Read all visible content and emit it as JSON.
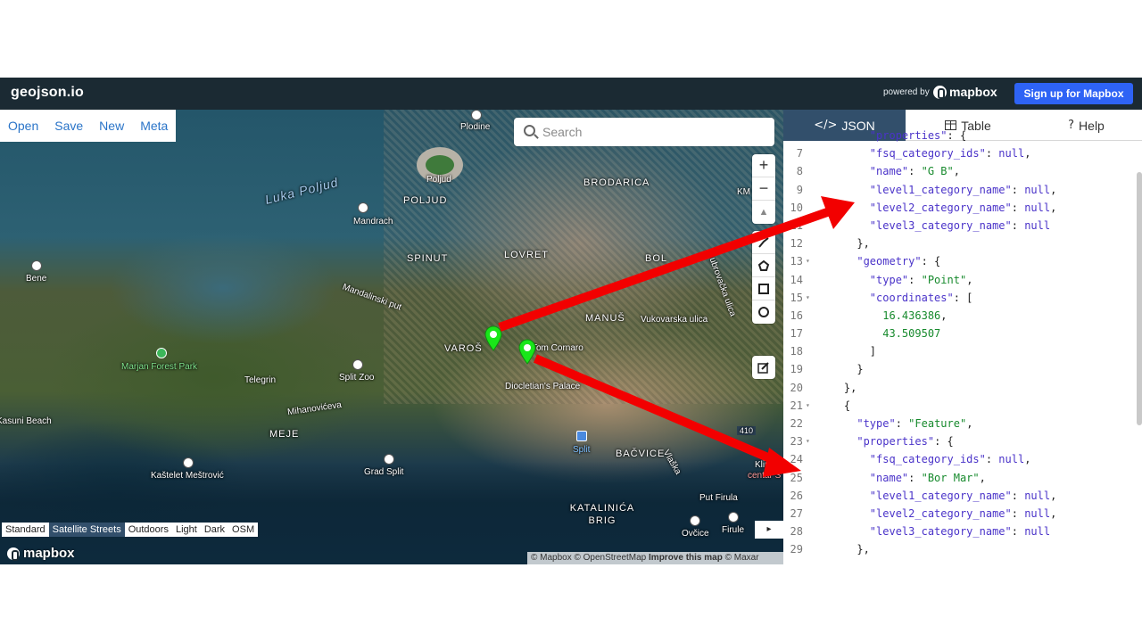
{
  "header": {
    "brand": "geojson.io",
    "powered_by": "powered by",
    "mapbox_logo": "mapbox",
    "signup_label": "Sign up for Mapbox"
  },
  "menu": {
    "open": "Open",
    "save": "Save",
    "new": "New",
    "meta": "Meta"
  },
  "search": {
    "placeholder": "Search"
  },
  "controls": {
    "zoom_in": "+",
    "zoom_out": "−",
    "compass": "▲"
  },
  "map_labels": [
    "Poljud",
    "Luka Poljud",
    "Mandrach",
    "POLJUD",
    "BRODARICA",
    "Plodine",
    "KM",
    "SPINUT",
    "LOVRET",
    "BOL",
    "Bene",
    "Mandalinski put",
    "Vukovarska ulica",
    "MANUŠ",
    "Dubrovačka ulica",
    "VAROŠ",
    "Tom Cornaro",
    "Diocletian's Palace",
    "Marjan Forest Park",
    "Telegrin",
    "Split Zoo",
    "Kasuni Beach",
    "Mihanovićeva",
    "MEJE",
    "Kaštelet Meštrović",
    "Grad Split",
    "Split",
    "BAČVICE",
    "Kliniy",
    "centar S",
    "Vlaška",
    "Put Firula",
    "KATALINIĆA BRIG",
    "Ovčice",
    "Firule",
    "410"
  ],
  "map_styles": [
    "Standard",
    "Satellite Streets",
    "Outdoors",
    "Light",
    "Dark",
    "OSM"
  ],
  "map_styles_active": "Satellite Streets",
  "map_logo": "mapbox",
  "attribution": {
    "a": "© Mapbox © OpenStreetMap ",
    "improve": "Improve this map",
    "b": " © Maxar"
  },
  "expand": "▸",
  "tabs": {
    "json": "JSON",
    "table": "Table",
    "help": "Help"
  },
  "icons": {
    "json": "code-icon",
    "table": "table-icon",
    "help": "help-icon"
  },
  "code_lines": [
    {
      "n": "",
      "t": "        \"properties\": {"
    },
    {
      "n": "7",
      "t": "        \"fsq_category_ids\": null,"
    },
    {
      "n": "8",
      "t": "        \"name\": \"G B\","
    },
    {
      "n": "9",
      "t": "        \"level1_category_name\": null,"
    },
    {
      "n": "10",
      "t": "        \"level2_category_name\": null,"
    },
    {
      "n": "11",
      "t": "        \"level3_category_name\": null"
    },
    {
      "n": "12",
      "t": "      },"
    },
    {
      "n": "13",
      "t": "      \"geometry\": {",
      "fold": true
    },
    {
      "n": "14",
      "t": "        \"type\": \"Point\","
    },
    {
      "n": "15",
      "t": "        \"coordinates\": [",
      "fold": true
    },
    {
      "n": "16",
      "t": "          16.436386,"
    },
    {
      "n": "17",
      "t": "          43.509507"
    },
    {
      "n": "18",
      "t": "        ]"
    },
    {
      "n": "19",
      "t": "      }"
    },
    {
      "n": "20",
      "t": "    },"
    },
    {
      "n": "21",
      "t": "    {",
      "fold": true
    },
    {
      "n": "22",
      "t": "      \"type\": \"Feature\","
    },
    {
      "n": "23",
      "t": "      \"properties\": {",
      "fold": true
    },
    {
      "n": "24",
      "t": "        \"fsq_category_ids\": null,"
    },
    {
      "n": "25",
      "t": "        \"name\": \"Bor Mar\","
    },
    {
      "n": "26",
      "t": "        \"level1_category_name\": null,"
    },
    {
      "n": "27",
      "t": "        \"level2_category_name\": null,"
    },
    {
      "n": "28",
      "t": "        \"level3_category_name\": null"
    },
    {
      "n": "29",
      "t": "      },"
    }
  ],
  "colors": {
    "header_bg": "#1b2a33",
    "signup_bg": "#2e63f5",
    "active_tab_bg": "#324f6b",
    "marker_green": "#19e619",
    "arrow_red": "#f20000"
  }
}
